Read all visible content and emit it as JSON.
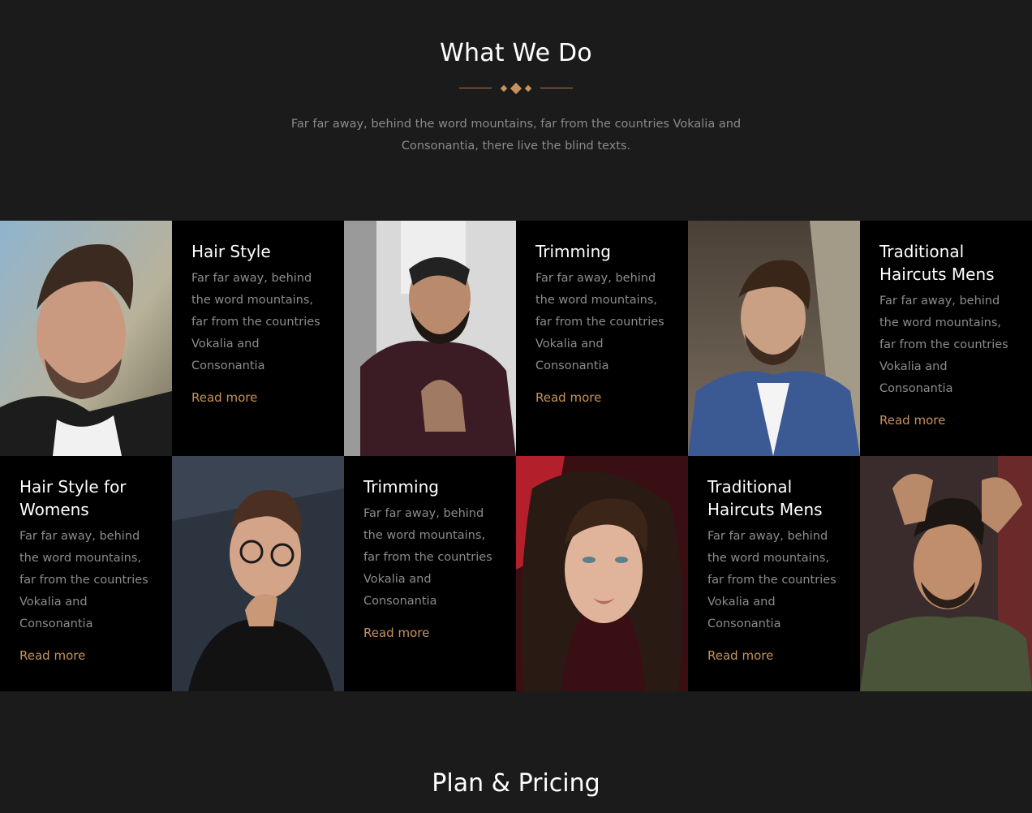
{
  "section": {
    "title": "What We Do",
    "intro": "Far far away, behind the word mountains, far from the countries Vokalia and Consonantia, there live the blind texts."
  },
  "cards": [
    {
      "title": "Hair Style",
      "desc": "Far far away, behind the word mountains, far from the countries Vokalia and Consonantia",
      "link": "Read more"
    },
    {
      "title": "Trimming",
      "desc": "Far far away, behind the word mountains, far from the countries Vokalia and Consonantia",
      "link": "Read more"
    },
    {
      "title": "Traditional Haircuts Mens",
      "desc": "Far far away, behind the word mountains, far from the countries Vokalia and Consonantia",
      "link": "Read more"
    },
    {
      "title": "Hair Style for Womens",
      "desc": "Far far away, behind the word mountains, far from the countries Vokalia and Consonantia",
      "link": "Read more"
    },
    {
      "title": "Trimming",
      "desc": "Far far away, behind the word mountains, far from the countries Vokalia and Consonantia",
      "link": "Read more"
    },
    {
      "title": "Traditional Haircuts Mens",
      "desc": "Far far away, behind the word mountains, far from the countries Vokalia and Consonantia",
      "link": "Read more"
    }
  ],
  "colors": {
    "background": "#1b1b1b",
    "card_background": "#000000",
    "accent": "#c8925a"
  },
  "pricing": {
    "title": "Plan & Pricing"
  }
}
